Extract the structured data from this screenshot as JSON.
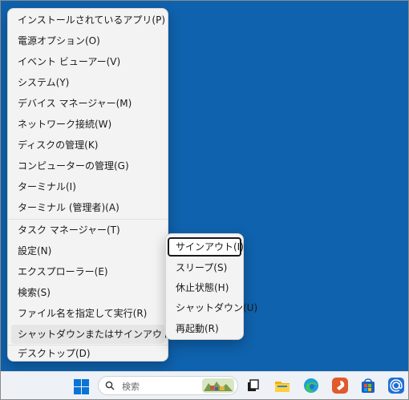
{
  "menu": {
    "items": [
      {
        "label": "インストールされているアプリ(P)"
      },
      {
        "label": "電源オプション(O)"
      },
      {
        "label": "イベント ビューアー(V)"
      },
      {
        "label": "システム(Y)"
      },
      {
        "label": "デバイス マネージャー(M)"
      },
      {
        "label": "ネットワーク接続(W)"
      },
      {
        "label": "ディスクの管理(K)"
      },
      {
        "label": "コンピューターの管理(G)"
      },
      {
        "label": "ターミナル(I)"
      },
      {
        "label": "ターミナル (管理者)(A)"
      },
      {
        "label": "タスク マネージャー(T)"
      },
      {
        "label": "設定(N)"
      },
      {
        "label": "エクスプローラー(E)"
      },
      {
        "label": "検索(S)"
      },
      {
        "label": "ファイル名を指定して実行(R)"
      },
      {
        "label": "シャットダウンまたはサインアウト(U)",
        "submenu_indicator": "›"
      },
      {
        "label": "デスクトップ(D)"
      }
    ]
  },
  "submenu": {
    "items": [
      {
        "label": "サインアウト(I)"
      },
      {
        "label": "スリープ(S)"
      },
      {
        "label": "休止状態(H)"
      },
      {
        "label": "シャットダウン(U)"
      },
      {
        "label": "再起動(R)"
      }
    ]
  },
  "taskbar": {
    "search_placeholder": "検索",
    "icons": [
      "start-icon",
      "search-icon",
      "task-view-icon",
      "file-explorer-icon",
      "edge-icon",
      "app-icon",
      "store-icon",
      "mail-icon"
    ]
  },
  "colors": {
    "desktop": "#0f62ad",
    "menu_bg": "#f3f3f3",
    "taskbar_bg": "#eef1f6",
    "accent": "#0a74d6"
  }
}
